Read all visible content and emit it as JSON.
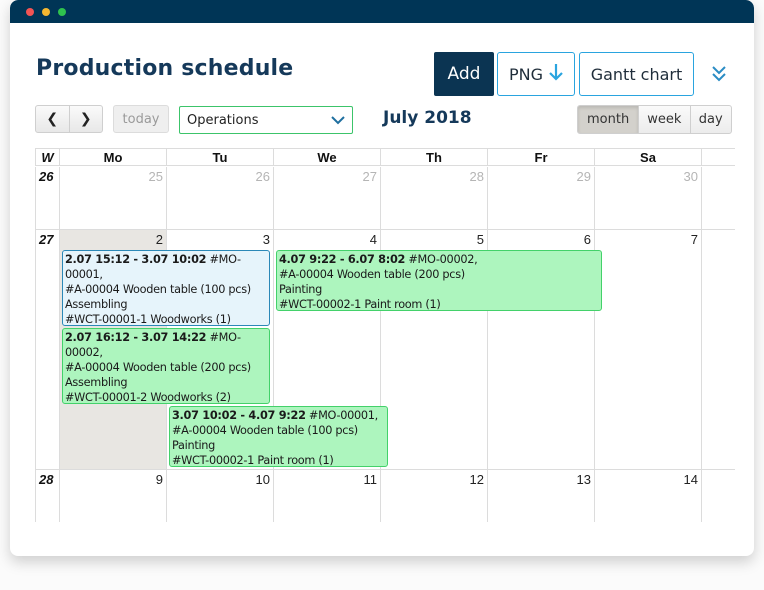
{
  "window": {
    "controls": [
      "close",
      "minimize",
      "maximize"
    ]
  },
  "header": {
    "title": "Production schedule",
    "add_label": "Add",
    "png_label": "PNG",
    "png_icon": "download-arrow-icon",
    "gantt_label": "Gantt chart",
    "more_icon": "double-chevron-down-icon"
  },
  "toolbar": {
    "prev_label": "❮",
    "next_label": "❯",
    "today_label": "today",
    "select_value": "Operations",
    "month_title": "July 2018",
    "views": [
      {
        "label": "month",
        "active": true
      },
      {
        "label": "week",
        "active": false
      },
      {
        "label": "day",
        "active": false
      }
    ]
  },
  "calendar": {
    "week_header": "W",
    "day_headers": [
      "Mo",
      "Tu",
      "We",
      "Th",
      "Fr",
      "Sa",
      ""
    ],
    "weeks": [
      {
        "week": "26",
        "days": [
          {
            "n": "25",
            "other": true
          },
          {
            "n": "26",
            "other": true
          },
          {
            "n": "27",
            "other": true
          },
          {
            "n": "28",
            "other": true
          },
          {
            "n": "29",
            "other": true
          },
          {
            "n": "30",
            "other": true
          },
          {
            "n": "",
            "other": true
          }
        ]
      },
      {
        "week": "27",
        "days": [
          {
            "n": "2",
            "today": true
          },
          {
            "n": "3"
          },
          {
            "n": "4"
          },
          {
            "n": "5"
          },
          {
            "n": "6"
          },
          {
            "n": "7"
          },
          {
            "n": ""
          }
        ]
      },
      {
        "week": "28",
        "days": [
          {
            "n": "9"
          },
          {
            "n": "10"
          },
          {
            "n": "11"
          },
          {
            "n": "12"
          },
          {
            "n": "13"
          },
          {
            "n": "14"
          },
          {
            "n": ""
          }
        ]
      }
    ],
    "events": [
      {
        "time": "2.07 15:12 - 3.07 10:02",
        "order": "#MO-00001,",
        "article": "#A-00004 Wooden table (100 pcs)",
        "operation": "Assembling",
        "workcenter": "#WCT-00001-1 Woodworks (1)",
        "color": "blue"
      },
      {
        "time": "2.07 16:12 - 3.07 14:22",
        "order": "#MO-00002,",
        "article": "#A-00004 Wooden table (200 pcs)",
        "operation": "Assembling",
        "workcenter": "#WCT-00001-2 Woodworks (2)",
        "color": "green"
      },
      {
        "time": "3.07 10:02 - 4.07 9:22",
        "order": "#MO-00001,",
        "article": "#A-00004 Wooden table (100 pcs)",
        "operation": "Painting",
        "workcenter": "#WCT-00002-1 Paint room (1)",
        "color": "green"
      },
      {
        "time": "4.07 9:22 - 6.07 8:02",
        "order": "#MO-00002,",
        "article": "#A-00004 Wooden table (200 pcs)",
        "operation": "Painting",
        "workcenter": "#WCT-00002-1 Paint room (1)",
        "color": "green"
      }
    ]
  },
  "colors": {
    "titlebar": "#003556",
    "brand": "#0b3452",
    "accent": "#2aa4df",
    "event_blue_bg": "#e6f4fb",
    "event_green_bg": "#adf5be",
    "select_border": "#3cc46a"
  }
}
